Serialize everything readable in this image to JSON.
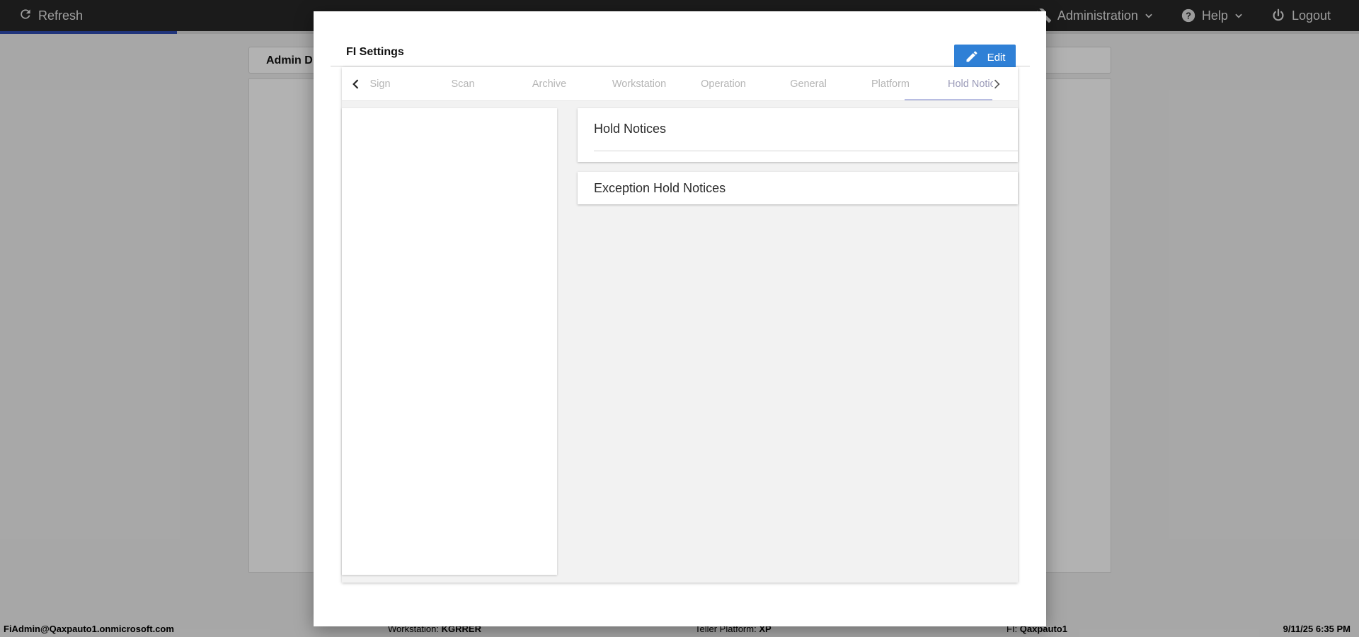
{
  "topbar": {
    "refresh_label": "Refresh",
    "administration_label": "Administration",
    "help_label": "Help",
    "logout_label": "Logout"
  },
  "background": {
    "tab_label": "Admin D"
  },
  "statusbar": {
    "user": "FiAdmin@Qaxpauto1.onmicrosoft.com",
    "workstation_label": "Workstation:",
    "workstation_value": "KGRRER",
    "teller_platform_label": "Teller Platform:",
    "teller_platform_value": "XP",
    "fi_label": "FI:",
    "fi_value": "Qaxpauto1",
    "datetime": "9/11/25 6:35 PM"
  },
  "modal": {
    "title": "FI Settings",
    "edit_label": "Edit",
    "tabs": [
      {
        "label": "Sign"
      },
      {
        "label": "Scan"
      },
      {
        "label": "Archive"
      },
      {
        "label": "Workstation"
      },
      {
        "label": "Operation"
      },
      {
        "label": "General"
      },
      {
        "label": "Platform"
      },
      {
        "label": "Hold Notic"
      }
    ],
    "active_tab": "Hold Notic",
    "sections": [
      {
        "title": "Hold Notices"
      },
      {
        "title": "Exception Hold Notices"
      }
    ]
  },
  "colors": {
    "accent": "#2f80d6",
    "topbar": "#272727",
    "progress": "#2f4bb0"
  }
}
